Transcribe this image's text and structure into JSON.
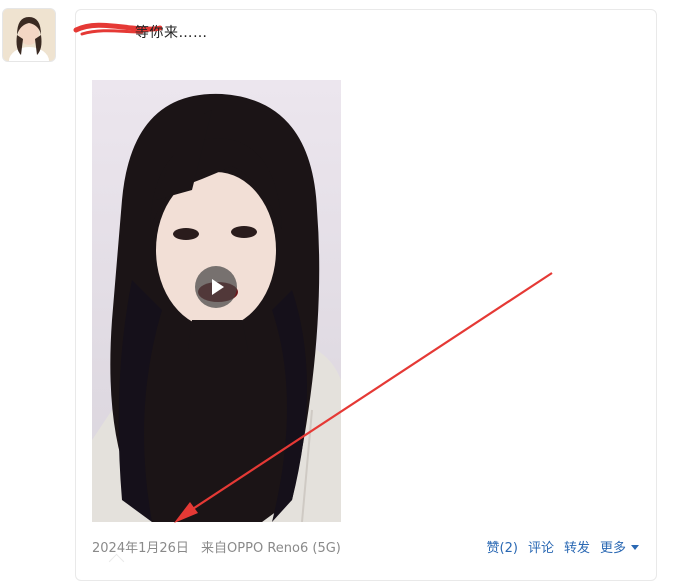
{
  "post": {
    "text": "等你来……",
    "date": "2024年1月26日",
    "source": "来自OPPO Reno6 (5G)"
  },
  "actions": {
    "like": "赞(2)",
    "comment": "评论",
    "repost": "转发",
    "more": "更多"
  },
  "icons": {
    "play": "play-icon",
    "caret": "chevron-down-icon"
  },
  "colors": {
    "link": "#2a68b3",
    "meta_text": "#8a8a8a",
    "annotation_red": "#e53935"
  }
}
